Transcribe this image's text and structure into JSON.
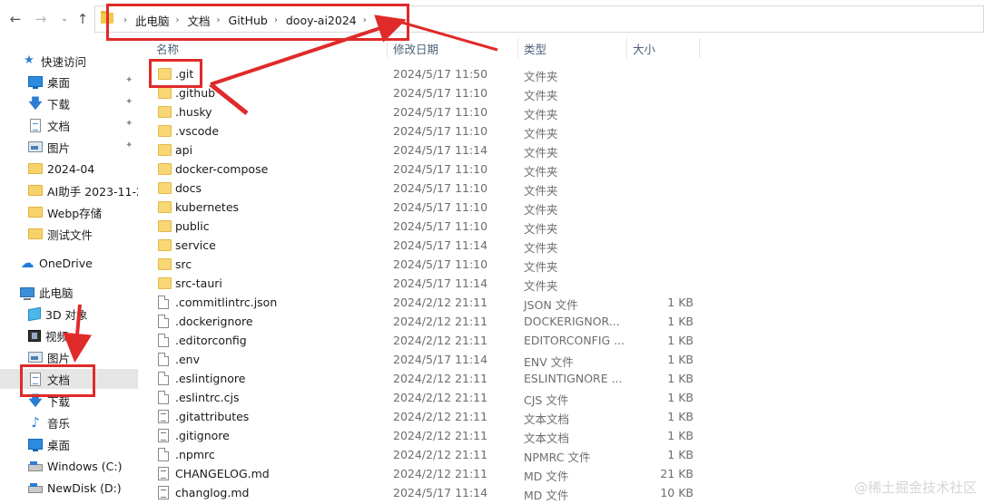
{
  "nav": {
    "back_icon": "←",
    "forward_icon": "→",
    "recent_icon": "⌄",
    "up_icon": "↑",
    "breadcrumbs": [
      "此电脑",
      "文档",
      "GitHub",
      "dooy-ai2024"
    ],
    "crumb_separator": "›"
  },
  "sidebar": {
    "quick_access": "快速访问",
    "quick_items": [
      {
        "label": "桌面",
        "icon": "desktop-icon",
        "pinned": true
      },
      {
        "label": "下载",
        "icon": "download-icon",
        "pinned": true
      },
      {
        "label": "文档",
        "icon": "document-icon",
        "pinned": true
      },
      {
        "label": "图片",
        "icon": "picture-icon",
        "pinned": true
      },
      {
        "label": "2024-04",
        "icon": "folder-icon",
        "pinned": false
      },
      {
        "label": "AI助手 2023-11-2",
        "icon": "folder-icon",
        "pinned": false
      },
      {
        "label": "Webp存储",
        "icon": "folder-icon",
        "pinned": false
      },
      {
        "label": "测试文件",
        "icon": "folder-icon",
        "pinned": false
      }
    ],
    "onedrive": "OneDrive",
    "this_pc": "此电脑",
    "pc_items": [
      {
        "label": "3D 对象",
        "icon": "3d-objects-icon"
      },
      {
        "label": "视频",
        "icon": "video-icon"
      },
      {
        "label": "图片",
        "icon": "picture-icon"
      },
      {
        "label": "文档",
        "icon": "document-icon",
        "selected": true
      },
      {
        "label": "下载",
        "icon": "download-icon"
      },
      {
        "label": "音乐",
        "icon": "music-icon"
      },
      {
        "label": "桌面",
        "icon": "desktop-icon"
      },
      {
        "label": "Windows (C:)",
        "icon": "drive-icon"
      },
      {
        "label": "NewDisk (D:)",
        "icon": "drive-icon"
      }
    ],
    "pin_glyph": "📌"
  },
  "columns": {
    "name": "名称",
    "date": "修改日期",
    "type": "类型",
    "size": "大小"
  },
  "files": [
    {
      "name": ".git",
      "date": "2024/5/17 11:50",
      "type": "文件夹",
      "size": "",
      "kind": "folder"
    },
    {
      "name": ".github",
      "date": "2024/5/17 11:10",
      "type": "文件夹",
      "size": "",
      "kind": "folder"
    },
    {
      "name": ".husky",
      "date": "2024/5/17 11:10",
      "type": "文件夹",
      "size": "",
      "kind": "folder"
    },
    {
      "name": ".vscode",
      "date": "2024/5/17 11:10",
      "type": "文件夹",
      "size": "",
      "kind": "folder"
    },
    {
      "name": "api",
      "date": "2024/5/17 11:14",
      "type": "文件夹",
      "size": "",
      "kind": "folder"
    },
    {
      "name": "docker-compose",
      "date": "2024/5/17 11:10",
      "type": "文件夹",
      "size": "",
      "kind": "folder"
    },
    {
      "name": "docs",
      "date": "2024/5/17 11:10",
      "type": "文件夹",
      "size": "",
      "kind": "folder"
    },
    {
      "name": "kubernetes",
      "date": "2024/5/17 11:10",
      "type": "文件夹",
      "size": "",
      "kind": "folder"
    },
    {
      "name": "public",
      "date": "2024/5/17 11:10",
      "type": "文件夹",
      "size": "",
      "kind": "folder"
    },
    {
      "name": "service",
      "date": "2024/5/17 11:14",
      "type": "文件夹",
      "size": "",
      "kind": "folder"
    },
    {
      "name": "src",
      "date": "2024/5/17 11:10",
      "type": "文件夹",
      "size": "",
      "kind": "folder"
    },
    {
      "name": "src-tauri",
      "date": "2024/5/17 11:14",
      "type": "文件夹",
      "size": "",
      "kind": "folder"
    },
    {
      "name": ".commitlintrc.json",
      "date": "2024/2/12 21:11",
      "type": "JSON 文件",
      "size": "1 KB",
      "kind": "file"
    },
    {
      "name": ".dockerignore",
      "date": "2024/2/12 21:11",
      "type": "DOCKERIGNOR...",
      "size": "1 KB",
      "kind": "file"
    },
    {
      "name": ".editorconfig",
      "date": "2024/2/12 21:11",
      "type": "EDITORCONFIG ...",
      "size": "1 KB",
      "kind": "file"
    },
    {
      "name": ".env",
      "date": "2024/5/17 11:14",
      "type": "ENV 文件",
      "size": "1 KB",
      "kind": "file"
    },
    {
      "name": ".eslintignore",
      "date": "2024/2/12 21:11",
      "type": "ESLINTIGNORE ...",
      "size": "1 KB",
      "kind": "file"
    },
    {
      "name": ".eslintrc.cjs",
      "date": "2024/2/12 21:11",
      "type": "CJS 文件",
      "size": "1 KB",
      "kind": "file"
    },
    {
      "name": ".gitattributes",
      "date": "2024/2/12 21:11",
      "type": "文本文档",
      "size": "1 KB",
      "kind": "text"
    },
    {
      "name": ".gitignore",
      "date": "2024/2/12 21:11",
      "type": "文本文档",
      "size": "1 KB",
      "kind": "text"
    },
    {
      "name": ".npmrc",
      "date": "2024/2/12 21:11",
      "type": "NPMRC 文件",
      "size": "1 KB",
      "kind": "file"
    },
    {
      "name": "CHANGELOG.md",
      "date": "2024/2/12 21:11",
      "type": "MD 文件",
      "size": "21 KB",
      "kind": "text"
    },
    {
      "name": "changlog.md",
      "date": "2024/5/17 11:14",
      "type": "MD 文件",
      "size": "10 KB",
      "kind": "text"
    }
  ],
  "watermark": "@稀土掘金技术社区",
  "annotation_color": "#e02a2a"
}
